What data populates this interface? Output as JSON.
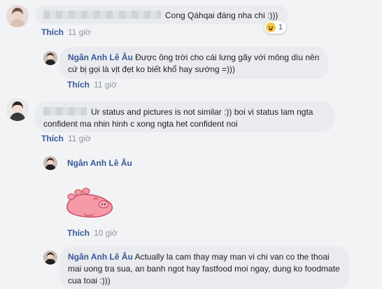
{
  "comments": [
    {
      "text": "Cong Qáhqai đáng nha chi :)))",
      "reactions": {
        "count": "1",
        "type": "haha-icon"
      },
      "action_label": "Thích",
      "time": "11 giờ"
    },
    {
      "author": "Ngân Anh Lê Âu",
      "text": "Được ông trời cho cái lưng gãy với mông dìu nên cứ bị gọi là vịt đẹt ko biết khổ hay sướng =)))",
      "action_label": "Thích",
      "time": "11 giờ"
    },
    {
      "text": "Ur status and pictures is not similar :)) boi vi status lam ngta confident ma nhin hinh c xong ngta het confident noi",
      "action_label": "Thích",
      "time": "11 giờ"
    },
    {
      "author": "Ngân Anh Lê Âu",
      "sticker": "pink-pig-sticker",
      "action_label": "Thích",
      "time": "10 giờ"
    },
    {
      "author": "Ngân Anh Lê Âu",
      "text": "Actually la cam thay may man vi chi van co the thoai mai uong tra sua, an banh ngot hay fastfood moi ngay, dung ko foodmate cua toai :)))"
    }
  ],
  "colors": {
    "author": "#385898",
    "bubble": "#e9ebee",
    "time": "#90949c",
    "background": "#f2f3f5"
  }
}
